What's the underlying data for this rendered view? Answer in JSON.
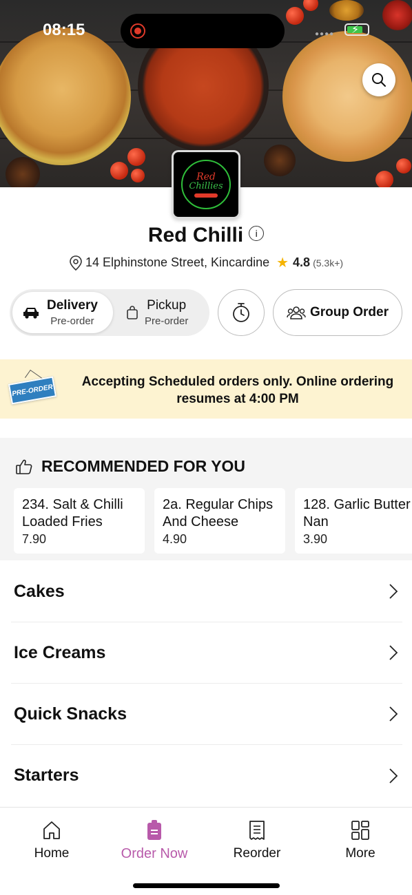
{
  "status_bar": {
    "time": "08:15"
  },
  "restaurant": {
    "name": "Red Chilli",
    "address": "14 Elphinstone Street, Kincardine",
    "rating": "4.8",
    "rating_count": "(5.3k+)",
    "logo_text_1": "Red",
    "logo_text_2": "Chillies"
  },
  "order_mode": {
    "delivery_label": "Delivery",
    "delivery_sub": "Pre-order",
    "pickup_label": "Pickup",
    "pickup_sub": "Pre-order",
    "selected": "delivery"
  },
  "group_order_label": "Group Order",
  "banner": {
    "sign_text": "PRE-ORDER",
    "message": "Accepting Scheduled orders only. Online ordering resumes at 4:00 PM"
  },
  "recommended": {
    "title": "RECOMMENDED FOR YOU",
    "items": [
      {
        "name_line1": "234. Salt & Chilli",
        "name_line2": "Loaded Fries",
        "price": "7.90"
      },
      {
        "name_line1": "2a. Regular Chips",
        "name_line2": "And Cheese",
        "price": "4.90"
      },
      {
        "name_line1": "128. Garlic Butter",
        "name_line2": "Nan",
        "price": "3.90"
      }
    ]
  },
  "categories": [
    {
      "label": "Cakes"
    },
    {
      "label": "Ice Creams"
    },
    {
      "label": "Quick Snacks"
    },
    {
      "label": "Starters"
    }
  ],
  "bottom_nav": {
    "home": "Home",
    "order_now": "Order Now",
    "reorder": "Reorder",
    "more": "More",
    "active": "order_now",
    "active_color": "#b85aaa"
  },
  "icons": {
    "search": "search-icon",
    "info": "info-icon",
    "location": "location-pin-icon",
    "star": "star-icon",
    "car": "car-icon",
    "bag": "shopping-bag-icon",
    "timer": "timer-icon",
    "group": "group-icon",
    "thumbs_up": "thumbs-up-icon",
    "chevron": "chevron-right-icon"
  }
}
